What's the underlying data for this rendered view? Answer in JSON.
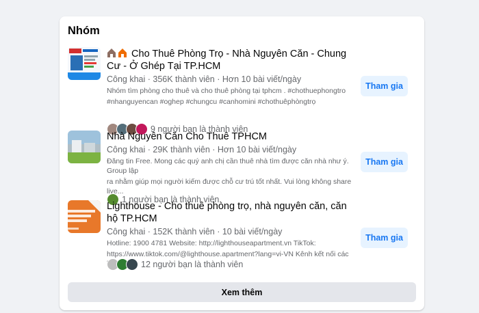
{
  "section": {
    "title": "Nhóm",
    "see_more": "Xem thêm"
  },
  "groups": [
    {
      "name": "Cho Thuê Phòng Trọ - Nhà Nguyên Căn - Chung Cư - Ở Ghép Tại TP.HCM",
      "meta": "Công khai · 356K thành viên · Hơn 10 bài viết/ngày",
      "desc1": "Nhóm tìm phòng cho thuê và cho thuê phòng tại tphcm . #chothuephongtro",
      "desc2": "#nhanguyencan #oghep #chungcu #canhomini #chothuêphòngtrọ",
      "friends": "9 người bạn là thành viên",
      "join": "Tham gia",
      "thumb_color": "#d9e6f2"
    },
    {
      "name": "Nhà Nguyên Căn Cho Thuê TPHCM",
      "meta": "Công khai · 29K thành viên · Hơn 10 bài viết/ngày",
      "desc1": "Đăng tin Free. Mong các quý anh chị cần thuê nhà tìm được căn nhà như ý. Group lập",
      "desc2": "ra nhằm giúp mọi người kiếm được chỗ cư trú tốt nhất. Vui lòng không share live...",
      "friends": "1 người bạn là thành viên",
      "join": "Tham gia",
      "thumb_color": "#8fb1c9"
    },
    {
      "name": "Lighthouse - Cho thuê phòng trọ, nhà nguyên căn, căn hộ TP.HCM",
      "meta": "Công khai · 152K thành viên · 10 bài viết/ngày",
      "desc1": "Hotline: 1900 4781 Website: http://lighthouseapartment.vn TikTok:",
      "desc2": "https://www.tiktok.com/@lighthouse.apartment?lang=vi-VN Kênh kết nối các bạn...",
      "friends": "12 người bạn là thành viên",
      "join": "Tham gia",
      "thumb_color": "#e8782a"
    }
  ],
  "colors": {
    "accent": "#1877f2",
    "join_bg": "#e7f3ff",
    "muted": "#65676b"
  }
}
